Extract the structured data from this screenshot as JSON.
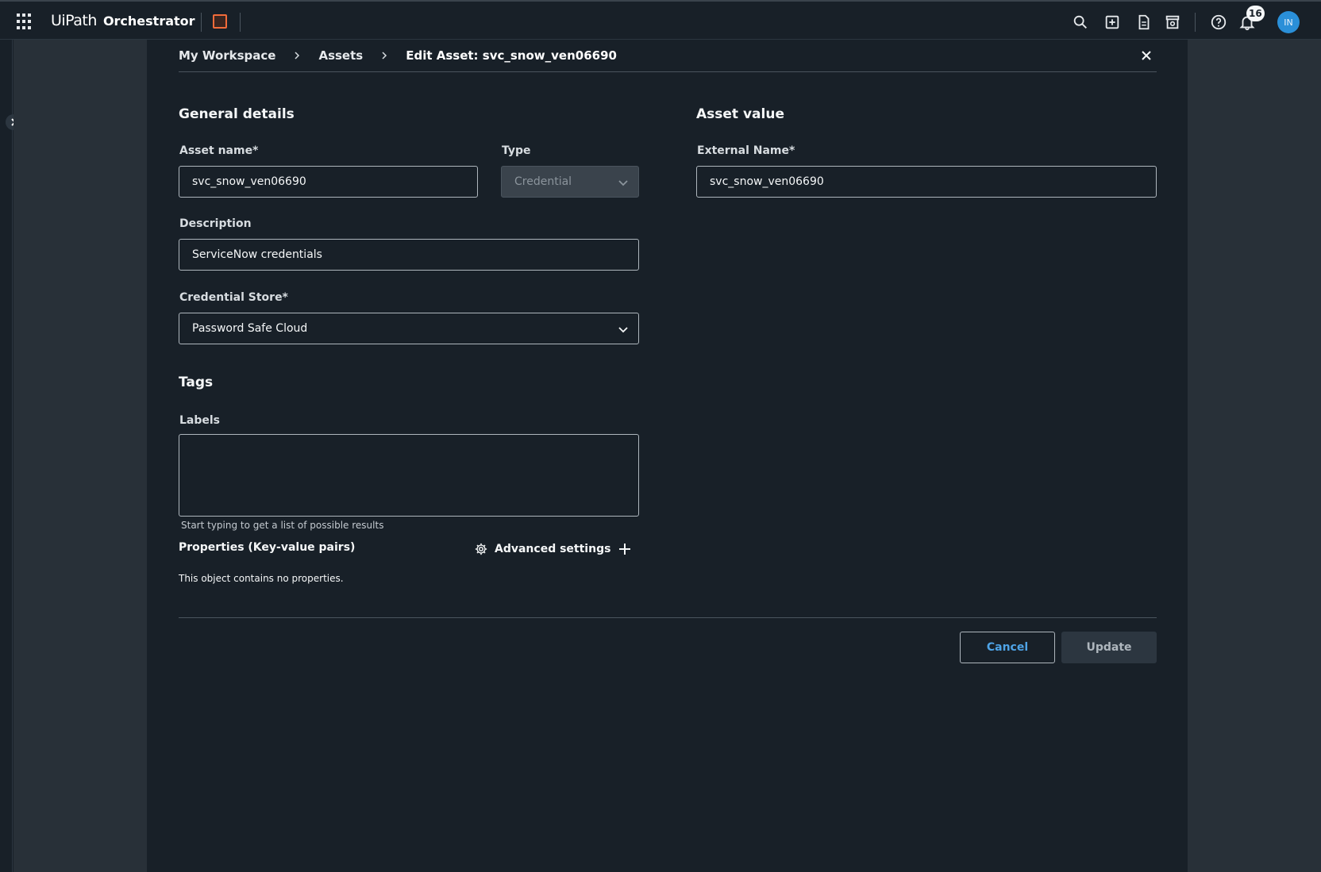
{
  "topbar": {
    "brand": "UiPath",
    "product": "Orchestrator",
    "notification_count": "16",
    "avatar_initials": "IN"
  },
  "breadcrumb": {
    "items": [
      "My Workspace",
      "Assets"
    ],
    "current": "Edit Asset: svc_snow_ven06690"
  },
  "general": {
    "title": "General details",
    "asset_name_label": "Asset name*",
    "asset_name_value": "svc_snow_ven06690",
    "type_label": "Type",
    "type_value": "Credential",
    "description_label": "Description",
    "description_value": "ServiceNow credentials",
    "credential_store_label": "Credential Store*",
    "credential_store_value": "Password Safe Cloud"
  },
  "asset_value": {
    "title": "Asset value",
    "external_name_label": "External Name*",
    "external_name_value": "svc_snow_ven06690"
  },
  "tags": {
    "title": "Tags",
    "labels_label": "Labels",
    "labels_value": "",
    "helper": "Start typing to get a list of possible results"
  },
  "properties": {
    "title": "Properties (Key-value pairs)",
    "advanced_label": "Advanced settings",
    "empty_text": "This object contains no properties."
  },
  "actions": {
    "cancel_label": "Cancel",
    "update_label": "Update"
  },
  "colors": {
    "background": "#182028",
    "backdrop": "#283038",
    "accent": "#4ea3e6",
    "avatar": "#2a8fd8",
    "tenant": "#f26b3a"
  }
}
